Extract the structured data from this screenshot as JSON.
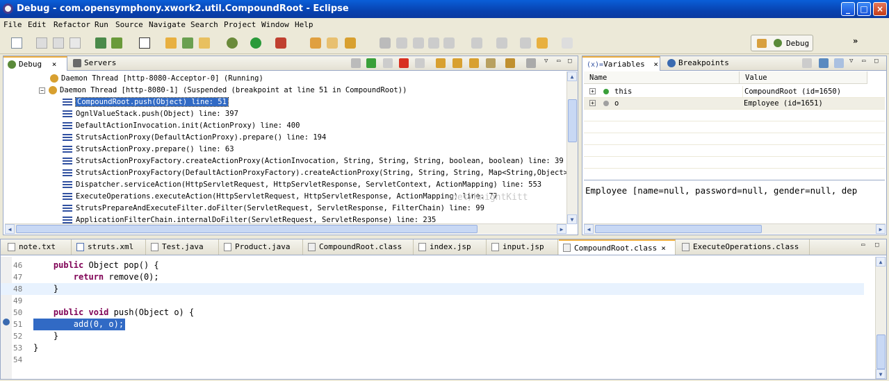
{
  "window": {
    "title": "Debug - com.opensymphony.xwork2.util.CompoundRoot - Eclipse",
    "min": "_",
    "max": "□",
    "close": "×"
  },
  "menu": [
    "File",
    "Edit",
    "Refactor",
    "Run",
    "Source",
    "Navigate",
    "Search",
    "Project",
    "Window",
    "Help"
  ],
  "perspective": {
    "label": "Debug",
    "overflow": "»"
  },
  "debug_view": {
    "tabs": [
      {
        "label": "Debug",
        "close": "×"
      },
      {
        "label": "Servers"
      }
    ],
    "threads": [
      {
        "label": "Daemon Thread [http-8080-Acceptor-0] (Running)"
      },
      {
        "label": "Daemon Thread [http-8080-1] (Suspended (breakpoint at line 51 in CompoundRoot))"
      }
    ],
    "frames": [
      "CompoundRoot.push(Object) line: 51",
      "OgnlValueStack.push(Object) line: 397",
      "DefaultActionInvocation.init(ActionProxy) line: 400",
      "StrutsActionProxy(DefaultActionProxy).prepare() line: 194",
      "StrutsActionProxy.prepare() line: 63",
      "StrutsActionProxyFactory.createActionProxy(ActionInvocation, String, String, String, boolean, boolean) line: 39",
      "StrutsActionProxyFactory(DefaultActionProxyFactory).createActionProxy(String, String, String, Map<String,Object>, bool",
      "Dispatcher.serviceAction(HttpServletRequest, HttpServletResponse, ServletContext, ActionMapping) line: 553",
      "ExecuteOperations.executeAction(HttpServletRequest, HttpServletResponse, ActionMapping) line: 77",
      "StrutsPrepareAndExecuteFilter.doFilter(ServletRequest, ServletResponse, FilterChain) line: 99",
      "ApplicationFilterChain.internalDoFilter(ServletRequest, ServletResponse) line: 235"
    ],
    "watermark": "net/KnightKitt"
  },
  "variables_view": {
    "tabs": [
      {
        "label": "Variables",
        "prefix": "(x)=",
        "close": "×"
      },
      {
        "label": "Breakpoints"
      }
    ],
    "columns": [
      "Name",
      "Value"
    ],
    "rows": [
      {
        "expand": "+",
        "name": "this",
        "value": "CompoundRoot  (id=1650)"
      },
      {
        "expand": "+",
        "name": "o",
        "value": "Employee  (id=1651)"
      }
    ],
    "detail": "Employee [name=null, password=null, gender=null, dep"
  },
  "editor": {
    "tabs": [
      "note.txt",
      "struts.xml",
      "Test.java",
      "Product.java",
      "CompoundRoot.class",
      "index.jsp",
      "input.jsp",
      "CompoundRoot.class",
      "ExecuteOperations.class"
    ],
    "active_tab_index": 7,
    "active_close": "×",
    "lines": [
      {
        "n": "46",
        "parts": [
          {
            "t": "    "
          },
          {
            "k": "public"
          },
          {
            "t": " Object pop() {"
          }
        ]
      },
      {
        "n": "47",
        "parts": [
          {
            "t": "        "
          },
          {
            "k": "return"
          },
          {
            "t": " remove(0);"
          }
        ]
      },
      {
        "n": "48",
        "parts": [
          {
            "t": "    }"
          }
        ]
      },
      {
        "n": "49",
        "parts": [
          {
            "t": ""
          }
        ]
      },
      {
        "n": "50",
        "parts": [
          {
            "t": "    "
          },
          {
            "k": "public"
          },
          {
            "t": " "
          },
          {
            "k": "void"
          },
          {
            "t": " push(Object o) {"
          }
        ]
      },
      {
        "n": "51",
        "parts": [
          {
            "t": "        add(0, o);"
          }
        ]
      },
      {
        "n": "52",
        "parts": [
          {
            "t": "    }"
          }
        ]
      },
      {
        "n": "53",
        "parts": [
          {
            "t": "}"
          }
        ]
      },
      {
        "n": "54",
        "parts": [
          {
            "t": ""
          }
        ]
      }
    ]
  }
}
